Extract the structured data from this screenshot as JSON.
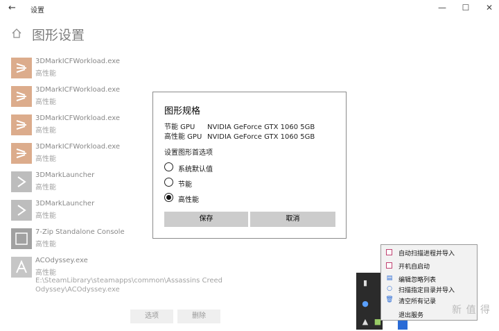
{
  "window": {
    "title": "设置",
    "back_icon": "back-arrow-icon",
    "minimize_glyph": "—",
    "maximize_glyph": "☐",
    "close_glyph": "✕"
  },
  "page": {
    "title": "图形设置",
    "apps": [
      {
        "name": "3DMarkICFWorkload.exe",
        "pref": "高性能",
        "icon": "3dmark-icon"
      },
      {
        "name": "3DMarkICFWorkload.exe",
        "pref": "高性能",
        "icon": "3dmark-icon"
      },
      {
        "name": "3DMarkICFWorkload.exe",
        "pref": "高性能",
        "icon": "3dmark-icon"
      },
      {
        "name": "3DMarkICFWorkload.exe",
        "pref": "高性能",
        "icon": "3dmark-icon"
      },
      {
        "name": "3DMarkLauncher",
        "pref": "高性能",
        "icon": "3dmark-launcher-icon"
      },
      {
        "name": "3DMarkLauncher",
        "pref": "高性能",
        "icon": "3dmark-launcher-icon"
      },
      {
        "name": "7-Zip Standalone Console",
        "pref": "高性能",
        "icon": "7zip-icon"
      },
      {
        "name": "ACOdyssey.exe",
        "pref": "高性能",
        "path": "E:\\SteamLibrary\\steamapps\\common\\Assassins Creed Odyssey\\ACOdyssey.exe",
        "icon": "acodyssey-icon"
      }
    ],
    "options_button": "选项",
    "delete_button": "删除"
  },
  "dialog": {
    "title": "图形规格",
    "power_saving_label": "节能 GPU",
    "power_saving_gpu": "NVIDIA GeForce GTX 1060 5GB",
    "high_perf_label": "高性能 GPU",
    "high_perf_gpu": "NVIDIA GeForce GTX 1060 5GB",
    "section": "设置图形首选项",
    "options": [
      {
        "label": "系统默认值",
        "selected": false
      },
      {
        "label": "节能",
        "selected": false
      },
      {
        "label": "高性能",
        "selected": true
      }
    ],
    "save": "保存",
    "cancel": "取消"
  },
  "context_menu": {
    "items": [
      {
        "label": "自动扫描进程并导入",
        "kind": "checkbox"
      },
      {
        "label": "开机自启动",
        "kind": "checkbox"
      },
      {
        "label": "编辑忽略列表",
        "kind": "icon",
        "icon": "edit-list-icon"
      },
      {
        "label": "扫描指定目录并导入",
        "kind": "icon",
        "icon": "scan-folder-icon"
      },
      {
        "label": "清空所有记录",
        "kind": "icon",
        "icon": "trash-icon"
      },
      {
        "label": "退出服务",
        "kind": "plain"
      }
    ]
  },
  "watermark": "新 值 得"
}
